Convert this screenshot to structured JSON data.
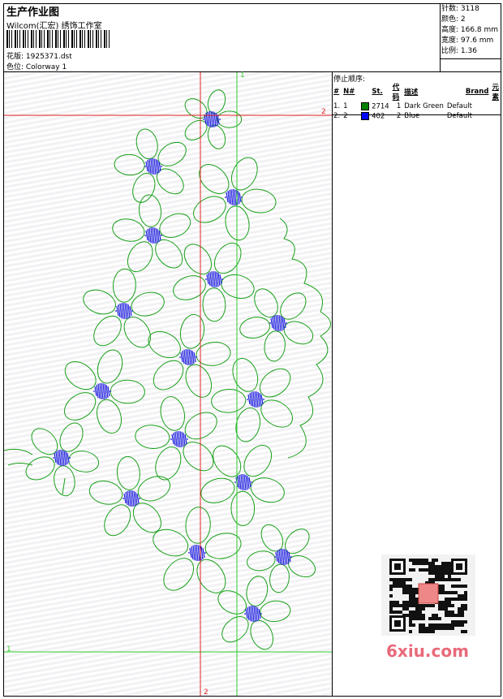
{
  "header": {
    "title": "生产作业图",
    "company": "Wilcom(汇宏) 绣饰工作室",
    "design_file": "花版: 1925371.dst",
    "colorway": "色位: Colorway 1"
  },
  "stats": [
    "针数: 3118",
    "颜色: 2",
    "高度: 166.8 mm",
    "宽度: 97.6 mm",
    "比例: 1.36"
  ],
  "stop_sequence": {
    "title": "停止顺序:",
    "columns": [
      "#",
      "N#",
      "St.",
      "代码",
      "描述",
      "Brand",
      "元素"
    ],
    "rows": [
      {
        "num": "1.",
        "n": "1",
        "stitches": "2714",
        "code": "1",
        "description": "Dark Green",
        "brand": "Default",
        "color": "#008000"
      },
      {
        "num": "2.",
        "n": "2",
        "stitches": "402",
        "code": "2",
        "description": "Blue",
        "brand": "Default",
        "color": "#0000ff"
      }
    ]
  },
  "guides": {
    "top_left_label": "1",
    "top_right_label": "2",
    "bottom_left_label": "1",
    "bottom_center_label": "2"
  },
  "watermark": "6xiu.com"
}
